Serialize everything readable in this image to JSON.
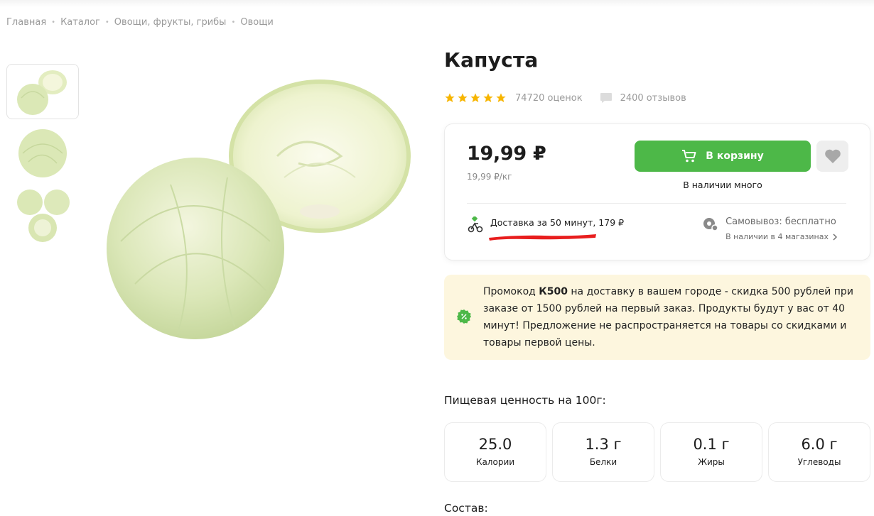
{
  "breadcrumb": [
    "Главная",
    "Каталог",
    "Овощи, фрукты, грибы",
    "Овощи"
  ],
  "product": {
    "title": "Капуста",
    "rating_count": "74720 оценок",
    "reviews_count": "2400 отзывов",
    "stars": 5
  },
  "price": {
    "value": "19,99 ₽",
    "per_unit": "19,99 ₽/кг",
    "cart_label": "В корзину",
    "stock": "В наличии много"
  },
  "delivery": {
    "text": "Доставка за 50 минут, 179 ₽"
  },
  "pickup": {
    "title": "Самовывоз: бесплатно",
    "link": "В наличии в 4 магазинах"
  },
  "promo": {
    "before": "Промокод ",
    "code": "К500",
    "after": " на доставку в вашем городе - скидка 500 рублей при заказе от 1500 рублей на первый заказ. Продукты будут у вас от 40 минут! Предложение не распространяется на товары со скидками и товары первой цены."
  },
  "nutrition": {
    "title": "Пищевая ценность на 100г:",
    "items": [
      {
        "value": "25.0",
        "label": "Калории"
      },
      {
        "value": "1.3 г",
        "label": "Белки"
      },
      {
        "value": "0.1 г",
        "label": "Жиры"
      },
      {
        "value": "6.0 г",
        "label": "Углеводы"
      }
    ]
  },
  "composition_title": "Состав:",
  "colors": {
    "accent_green": "#4db848",
    "star": "#f7b500",
    "promo_bg": "#fdf6de"
  }
}
